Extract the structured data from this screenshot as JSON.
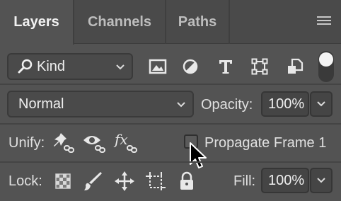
{
  "tabs": [
    {
      "label": "Layers",
      "active": true
    },
    {
      "label": "Channels",
      "active": false
    },
    {
      "label": "Paths",
      "active": false
    }
  ],
  "filter": {
    "kind_label": "Kind",
    "icons": [
      "image-filter-icon",
      "adjustment-filter-icon",
      "type-filter-icon",
      "shape-filter-icon",
      "smart-object-filter-icon"
    ]
  },
  "blend": {
    "mode": "Normal",
    "opacity_label": "Opacity:",
    "opacity_value": "100%"
  },
  "unify": {
    "label": "Unify:",
    "propagate_label": "Propagate Frame 1",
    "propagate_checked": false
  },
  "lock": {
    "label": "Lock:",
    "fill_label": "Fill:",
    "fill_value": "100%"
  },
  "colors": {
    "panel_bg": "#535353",
    "tab_bg": "#4a4a4a",
    "text": "#e6e6e6"
  }
}
